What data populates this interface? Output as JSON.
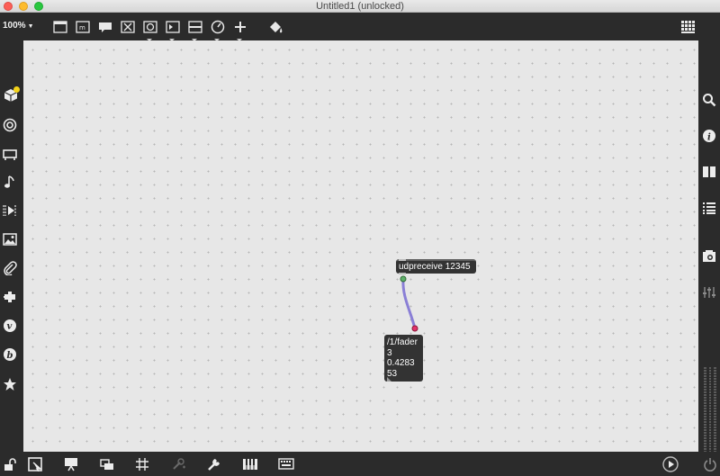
{
  "window": {
    "title": "Untitled1 (unlocked)"
  },
  "toolbar": {
    "zoom_label": "100%",
    "zoom_caret": "▼",
    "tools": [
      {
        "name": "presentation-window-icon"
      },
      {
        "name": "object-box-icon"
      },
      {
        "name": "comment-icon"
      },
      {
        "name": "toggle-icon"
      },
      {
        "name": "button-object-icon"
      },
      {
        "name": "number-box-icon"
      },
      {
        "name": "slider-icon"
      },
      {
        "name": "dial-icon"
      },
      {
        "name": "add-object-icon"
      },
      {
        "name": "paint-bucket-icon"
      },
      {
        "name": "grid-menu-icon"
      }
    ]
  },
  "left_sidebar": {
    "items": [
      {
        "name": "cube-icon",
        "badge_color": "#f4d31a"
      },
      {
        "name": "audio-icon"
      },
      {
        "name": "stage-icon"
      },
      {
        "name": "music-note-icon"
      },
      {
        "name": "video-icon"
      },
      {
        "name": "image-icon"
      },
      {
        "name": "paperclip-icon"
      },
      {
        "name": "plugin-icon"
      },
      {
        "name": "v-icon"
      },
      {
        "name": "b-icon"
      },
      {
        "name": "star-icon"
      }
    ]
  },
  "right_sidebar": {
    "items": [
      {
        "name": "search-icon"
      },
      {
        "name": "info-icon"
      },
      {
        "name": "reference-book-icon"
      },
      {
        "name": "list-icon"
      },
      {
        "name": "snapshot-icon"
      },
      {
        "name": "mixer-icon"
      }
    ]
  },
  "patch": {
    "udpreceive": {
      "text": "udpreceive 12345"
    },
    "message": {
      "lines": [
        "/1/fader",
        "3",
        "0.4283",
        "53"
      ]
    },
    "patch_cord_color": "#8a7fd6"
  },
  "bottom_bar": {
    "items": [
      {
        "name": "lock-icon"
      },
      {
        "name": "edit-mode-icon"
      },
      {
        "name": "presentation-icon"
      },
      {
        "name": "window-stack-icon"
      },
      {
        "name": "grid-icon"
      },
      {
        "name": "debug-icon"
      },
      {
        "name": "wrench-icon"
      },
      {
        "name": "keyboard-icon"
      },
      {
        "name": "clue-icon"
      },
      {
        "name": "play-icon"
      },
      {
        "name": "power-icon"
      }
    ]
  }
}
